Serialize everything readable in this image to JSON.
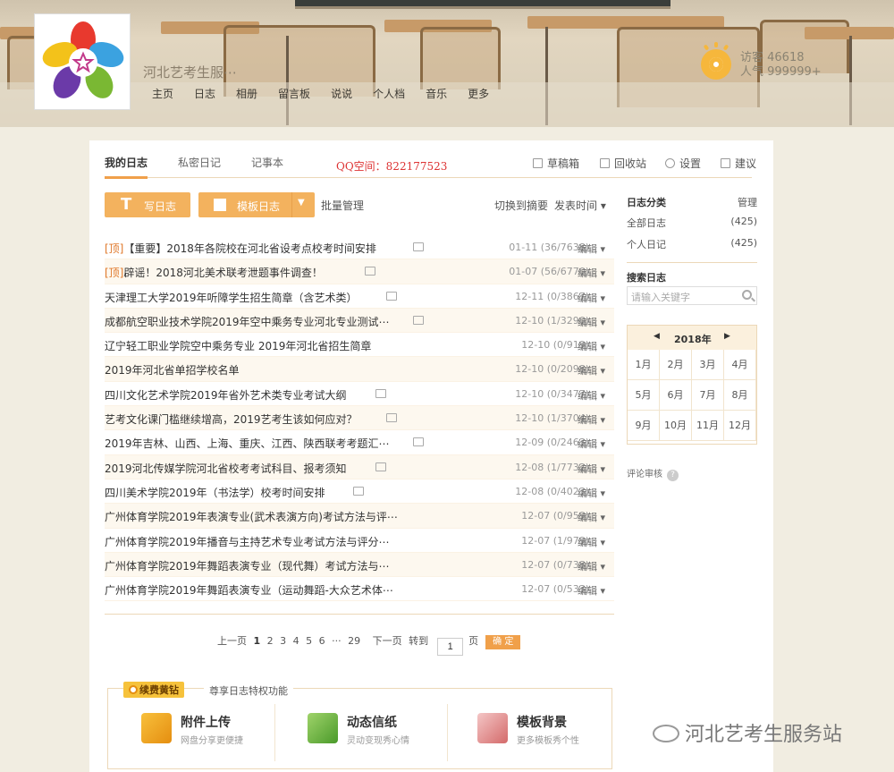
{
  "header": {
    "site_title": "河北艺考生服⋯",
    "nav": [
      "主页",
      "日志",
      "相册",
      "留言板",
      "说说",
      "个人档",
      "音乐",
      "更多"
    ],
    "visits_line1": "访客 46618",
    "visits_line2": "人气 999999+"
  },
  "tabs": [
    "我的日志",
    "私密日记",
    "记事本"
  ],
  "qq_text": "QQ空间：822177523",
  "tools": [
    "草稿箱",
    "回收站",
    "设置",
    "建议"
  ],
  "buttons": {
    "write": "写日志",
    "template": "模板日志",
    "batch": "批量管理",
    "switch": "切换到摘要",
    "sort": "发表时间"
  },
  "posts": [
    {
      "top": "[顶]",
      "title": "【重要】2018年各院校在河北省设考点校考时间安排",
      "pic": true,
      "date": "01-11",
      "stats": "(36/7638)"
    },
    {
      "top": "[顶]",
      "title": "辟谣！2018河北美术联考泄题事件调查！",
      "pic": true,
      "date": "01-07",
      "stats": "(56/6770)"
    },
    {
      "top": "",
      "title": "天津理工大学2019年听障学生招生简章（含艺术类）",
      "pic": true,
      "date": "12-11",
      "stats": "(0/3867)"
    },
    {
      "top": "",
      "title": "成都航空职业技术学院2019年空中乘务专业河北专业测试⋯",
      "pic": true,
      "date": "12-10",
      "stats": "(1/3290)"
    },
    {
      "top": "",
      "title": "辽宁轻工职业学院空中乘务专业 2019年河北省招生简章",
      "pic": false,
      "date": "12-10",
      "stats": "(0/919)"
    },
    {
      "top": "",
      "title": "2019年河北省单招学校名单",
      "pic": false,
      "date": "12-10",
      "stats": "(0/2098)"
    },
    {
      "top": "",
      "title": "四川文化艺术学院2019年省外艺术类专业考试大纲",
      "pic": true,
      "date": "12-10",
      "stats": "(0/3477)"
    },
    {
      "top": "",
      "title": "艺考文化课门槛继续增高，2019艺考生该如何应对？",
      "pic": true,
      "date": "12-10",
      "stats": "(1/3704)"
    },
    {
      "top": "",
      "title": "2019年吉林、山西、上海、重庆、江西、陕西联考考题汇⋯",
      "pic": true,
      "date": "12-09",
      "stats": "(0/2463)"
    },
    {
      "top": "",
      "title": "2019河北传媒学院河北省校考考试科目、报考须知",
      "pic": true,
      "date": "12-08",
      "stats": "(1/7732)"
    },
    {
      "top": "",
      "title": "四川美术学院2019年（书法学）校考时间安排",
      "pic": true,
      "date": "12-08",
      "stats": "(0/4023)"
    },
    {
      "top": "",
      "title": "广州体育学院2019年表演专业(武术表演方向)考试方法与评⋯",
      "pic": false,
      "date": "12-07",
      "stats": "(0/959)"
    },
    {
      "top": "",
      "title": "广州体育学院2019年播音与主持艺术专业考试方法与评分⋯",
      "pic": false,
      "date": "12-07",
      "stats": "(1/979)"
    },
    {
      "top": "",
      "title": "广州体育学院2019年舞蹈表演专业（现代舞）考试方法与⋯",
      "pic": false,
      "date": "12-07",
      "stats": "(0/738)"
    },
    {
      "top": "",
      "title": "广州体育学院2019年舞蹈表演专业（运动舞蹈-大众艺术体⋯",
      "pic": false,
      "date": "12-07",
      "stats": "(0/533)"
    }
  ],
  "edit_label": "编辑 ▾",
  "pager": {
    "prev": "上一页",
    "pages": [
      "1",
      "2",
      "3",
      "4",
      "5",
      "6",
      "···",
      "29"
    ],
    "next": "下一页",
    "goto": "转到",
    "value": "1",
    "page_unit": "页",
    "ok": "确 定"
  },
  "vip": {
    "badge": "续费黄钻",
    "desc": "尊享日志特权功能",
    "features": [
      {
        "h": "附件上传",
        "s": "网盘分享更便捷"
      },
      {
        "h": "动态信纸",
        "s": "灵动变现秀心情"
      },
      {
        "h": "模板背景",
        "s": "更多模板秀个性"
      }
    ]
  },
  "sidebar": {
    "cat_title": "日志分类",
    "manage": "管理",
    "cats": [
      {
        "name": "全部日志",
        "count": "(425)"
      },
      {
        "name": "个人日记",
        "count": "(425)"
      }
    ],
    "search_title": "搜索日志",
    "search_placeholder": "请输入关键字",
    "cal_year": "2018年",
    "months": [
      "1月",
      "2月",
      "3月",
      "4月",
      "5月",
      "6月",
      "7月",
      "8月",
      "9月",
      "10月",
      "11月",
      "12月"
    ],
    "review": "评论审核",
    "review_q": "?"
  },
  "watermark": "河北艺考生服务站",
  "colors": {
    "accent": "#f0a04a",
    "button": "#f3b25e",
    "top_tag": "#e0782a",
    "qq": "#dd3333"
  }
}
